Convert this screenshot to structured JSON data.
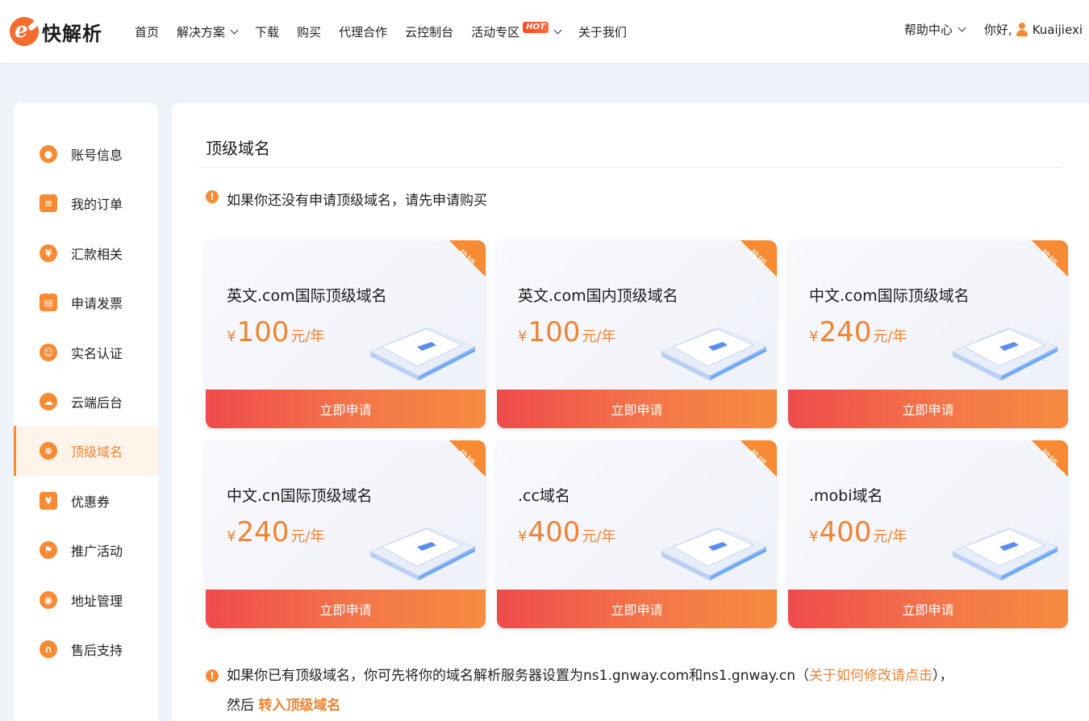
{
  "brand": {
    "name": "快解析"
  },
  "nav": {
    "items": [
      {
        "label": "首页"
      },
      {
        "label": "解决方案"
      },
      {
        "label": "下载"
      },
      {
        "label": "购买"
      },
      {
        "label": "代理合作"
      },
      {
        "label": "云控制台"
      },
      {
        "label": "活动专区",
        "badge": "HOT"
      },
      {
        "label": "关于我们"
      }
    ]
  },
  "header_right": {
    "help": "帮助中心",
    "greeting": "你好,",
    "username": "Kuaijiexi"
  },
  "sidebar": {
    "active_index": 6,
    "items": [
      {
        "label": "账号信息",
        "icon": "account-icon"
      },
      {
        "label": "我的订单",
        "icon": "order-icon"
      },
      {
        "label": "汇款相关",
        "icon": "yen-icon"
      },
      {
        "label": "申请发票",
        "icon": "printer-icon"
      },
      {
        "label": "实名认证",
        "icon": "id-verify-icon"
      },
      {
        "label": "云端后台",
        "icon": "cloud-icon"
      },
      {
        "label": "顶级域名",
        "icon": "globe-icon"
      },
      {
        "label": "优惠券",
        "icon": "coupon-icon"
      },
      {
        "label": "推广活动",
        "icon": "flag-icon"
      },
      {
        "label": "地址管理",
        "icon": "location-icon"
      },
      {
        "label": "售后支持",
        "icon": "headset-icon"
      }
    ]
  },
  "main": {
    "title": "顶级域名",
    "notice_top": "如果你还没有申请顶级域名，请先申请购买",
    "cards": [
      {
        "name": "英文.com国际顶级域名",
        "currency": "¥",
        "price": "100",
        "unit": "元/年",
        "ribbon": "热销",
        "button": "立即申请"
      },
      {
        "name": "英文.com国内顶级域名",
        "currency": "¥",
        "price": "100",
        "unit": "元/年",
        "ribbon": "热销",
        "button": "立即申请"
      },
      {
        "name": "中文.com国际顶级域名",
        "currency": "¥",
        "price": "240",
        "unit": "元/年",
        "ribbon": "热销",
        "button": "立即申请"
      },
      {
        "name": "中文.cn国际顶级域名",
        "currency": "¥",
        "price": "240",
        "unit": "元/年",
        "ribbon": "热销",
        "button": "立即申请"
      },
      {
        "name": ".cc域名",
        "currency": "¥",
        "price": "400",
        "unit": "元/年",
        "ribbon": "热销",
        "button": "立即申请"
      },
      {
        "name": ".mobi域名",
        "currency": "¥",
        "price": "400",
        "unit": "元/年",
        "ribbon": "热销",
        "button": "立即申请"
      }
    ],
    "notice_bottom": {
      "text": "如果你已有顶级域名，你可先将你的域名解析服务器设置为ns1.gnway.com和ns1.gnway.cn",
      "paren_open": "（",
      "link": "关于如何修改请点击",
      "paren_close": "），",
      "then": "然后",
      "transfer_link": "转入顶级域名"
    }
  },
  "colors": {
    "accent": "#f78a32",
    "button_start": "#ef4b4b",
    "button_end": "#f68b3e"
  }
}
